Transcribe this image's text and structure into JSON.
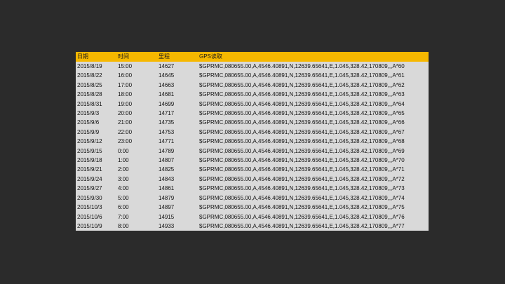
{
  "table": {
    "headers": [
      "日期",
      "时间",
      "里程",
      "GPS读取"
    ],
    "rows": [
      [
        "2015/8/19",
        "15:00",
        "14627",
        "$GPRMC,080655.00,A,4546.40891,N,12639.65641,E,1.045,328.42,170809,,,A*60"
      ],
      [
        "2015/8/22",
        "16:00",
        "14645",
        "$GPRMC,080655.00,A,4546.40891,N,12639.65641,E,1.045,328.42,170809,,,A*61"
      ],
      [
        "2015/8/25",
        "17:00",
        "14663",
        "$GPRMC,080655.00,A,4546.40891,N,12639.65641,E,1.045,328.42,170809,,,A*62"
      ],
      [
        "2015/8/28",
        "18:00",
        "14681",
        "$GPRMC,080655.00,A,4546.40891,N,12639.65641,E,1.045,328.42,170809,,,A*63"
      ],
      [
        "2015/8/31",
        "19:00",
        "14699",
        "$GPRMC,080655.00,A,4546.40891,N,12639.65641,E,1.045,328.42,170809,,,A*64"
      ],
      [
        "2015/9/3",
        "20:00",
        "14717",
        "$GPRMC,080655.00,A,4546.40891,N,12639.65641,E,1.045,328.42,170809,,,A*65"
      ],
      [
        "2015/9/6",
        "21:00",
        "14735",
        "$GPRMC,080655.00,A,4546.40891,N,12639.65641,E,1.045,328.42,170809,,,A*66"
      ],
      [
        "2015/9/9",
        "22:00",
        "14753",
        "$GPRMC,080655.00,A,4546.40891,N,12639.65641,E,1.045,328.42,170809,,,A*67"
      ],
      [
        "2015/9/12",
        "23:00",
        "14771",
        "$GPRMC,080655.00,A,4546.40891,N,12639.65641,E,1.045,328.42,170809,,,A*68"
      ],
      [
        "2015/9/15",
        "0:00",
        "14789",
        "$GPRMC,080655.00,A,4546.40891,N,12639.65641,E,1.045,328.42,170809,,,A*69"
      ],
      [
        "2015/9/18",
        "1:00",
        "14807",
        "$GPRMC,080655.00,A,4546.40891,N,12639.65641,E,1.045,328.42,170809,,,A*70"
      ],
      [
        "2015/9/21",
        "2:00",
        "14825",
        "$GPRMC,080655.00,A,4546.40891,N,12639.65641,E,1.045,328.42,170809,,,A*71"
      ],
      [
        "2015/9/24",
        "3:00",
        "14843",
        "$GPRMC,080655.00,A,4546.40891,N,12639.65641,E,1.045,328.42,170809,,,A*72"
      ],
      [
        "2015/9/27",
        "4:00",
        "14861",
        "$GPRMC,080655.00,A,4546.40891,N,12639.65641,E,1.045,328.42,170809,,,A*73"
      ],
      [
        "2015/9/30",
        "5:00",
        "14879",
        "$GPRMC,080655.00,A,4546.40891,N,12639.65641,E,1.045,328.42,170809,,,A*74"
      ],
      [
        "2015/10/3",
        "6:00",
        "14897",
        "$GPRMC,080655.00,A,4546.40891,N,12639.65641,E,1.045,328.42,170809,,,A*75"
      ],
      [
        "2015/10/6",
        "7:00",
        "14915",
        "$GPRMC,080655.00,A,4546.40891,N,12639.65641,E,1.045,328.42,170809,,,A*76"
      ],
      [
        "2015/10/9",
        "8:00",
        "14933",
        "$GPRMC,080655.00,A,4546.40891,N,12639.65641,E,1.045,328.42,170809,,,A*77"
      ]
    ]
  },
  "colors": {
    "background": "#2b2b2b",
    "header": "#f6b800",
    "row": "#d9d9d9"
  }
}
